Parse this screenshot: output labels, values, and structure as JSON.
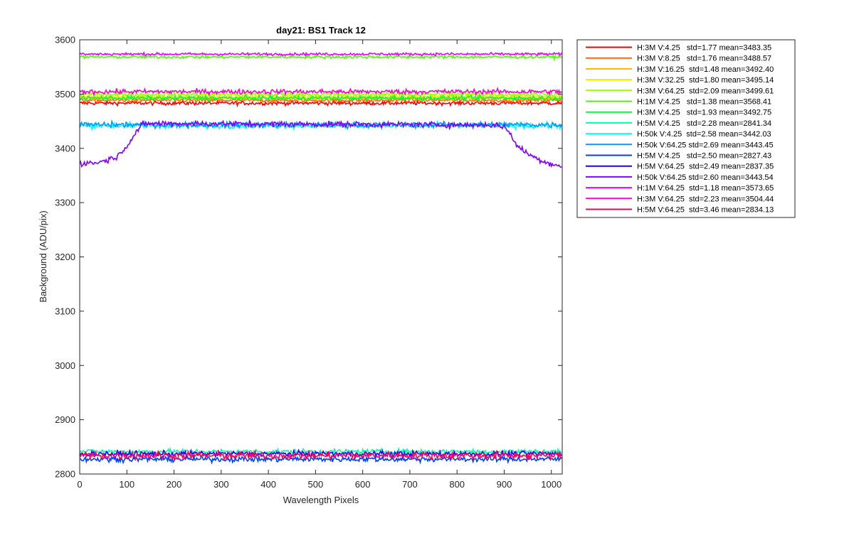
{
  "chart_data": {
    "type": "line",
    "title": "day21: BS1  Track 12",
    "xlabel": "Wavelength Pixels",
    "ylabel": "Background (ADU/pix)",
    "xlim": [
      0,
      1023
    ],
    "ylim": [
      2800,
      3600
    ],
    "xticks": [
      0,
      100,
      200,
      300,
      400,
      500,
      600,
      700,
      800,
      900,
      1000
    ],
    "yticks": [
      2800,
      2900,
      3000,
      3100,
      3200,
      3300,
      3400,
      3500,
      3600
    ],
    "grid": false,
    "legend_position": "outside-top-right",
    "series": [
      {
        "name": "H:3M V:4.25   std=1.77 mean=3483.35",
        "color": "#ff0000",
        "mean": 3483.35,
        "std": 1.77
      },
      {
        "name": "H:3M V:8.25   std=1.76 mean=3488.57",
        "color": "#ff6a00",
        "mean": 3488.57,
        "std": 1.76
      },
      {
        "name": "H:3M V:16.25  std=1.48 mean=3492.40",
        "color": "#ffb300",
        "mean": 3492.4,
        "std": 1.48
      },
      {
        "name": "H:3M V:32.25  std=1.80 mean=3495.14",
        "color": "#e6f000",
        "mean": 3495.14,
        "std": 1.8
      },
      {
        "name": "H:3M V:64.25  std=2.09 mean=3499.61",
        "color": "#99ff00",
        "mean": 3499.61,
        "std": 2.09
      },
      {
        "name": "H:1M V:4.25   std=1.38 mean=3568.41",
        "color": "#4cff00",
        "mean": 3568.41,
        "std": 1.38
      },
      {
        "name": "H:3M V:4.25   std=1.93 mean=3492.75",
        "color": "#00ff33",
        "mean": 3492.75,
        "std": 1.93
      },
      {
        "name": "H:5M V:4.25   std=2.28 mean=2841.34",
        "color": "#00ffaa",
        "mean": 2841.34,
        "std": 2.28
      },
      {
        "name": "H:50k V:4.25  std=2.58 mean=3442.03",
        "color": "#00ffff",
        "mean": 3442.03,
        "std": 2.58
      },
      {
        "name": "H:50k V:64.25 std=2.69 mean=3443.45",
        "color": "#0099ff",
        "mean": 3443.45,
        "std": 2.69
      },
      {
        "name": "H:5M V:4.25   std=2.50 mean=2827.43",
        "color": "#0040ff",
        "mean": 2827.43,
        "std": 2.5
      },
      {
        "name": "H:5M V:64.25  std=2.49 mean=2837.35",
        "color": "#1a00ff",
        "mean": 2837.35,
        "std": 2.49
      },
      {
        "name": "H:50k V:64.25 std=2.60 mean=3443.54",
        "color": "#8000ff",
        "mean": 3443.54,
        "std": 2.6,
        "shape": {
          "x": [
            0,
            40,
            80,
            100,
            120,
            130,
            150,
            880,
            900,
            910,
            930,
            960,
            990,
            1023
          ],
          "y": [
            3372,
            3374,
            3385,
            3405,
            3430,
            3442,
            3446,
            3443,
            3440,
            3430,
            3402,
            3385,
            3374,
            3366
          ]
        }
      },
      {
        "name": "H:1M V:64.25  std=1.18 mean=3573.65",
        "color": "#e600ff",
        "mean": 3573.65,
        "std": 1.18
      },
      {
        "name": "H:3M V:64.25  std=2.23 mean=3504.44",
        "color": "#ff00cc",
        "mean": 3504.44,
        "std": 2.23
      },
      {
        "name": "H:5M V:64.25  std=3.46 mean=2834.13",
        "color": "#ff0055",
        "mean": 2834.13,
        "std": 3.46
      }
    ]
  }
}
